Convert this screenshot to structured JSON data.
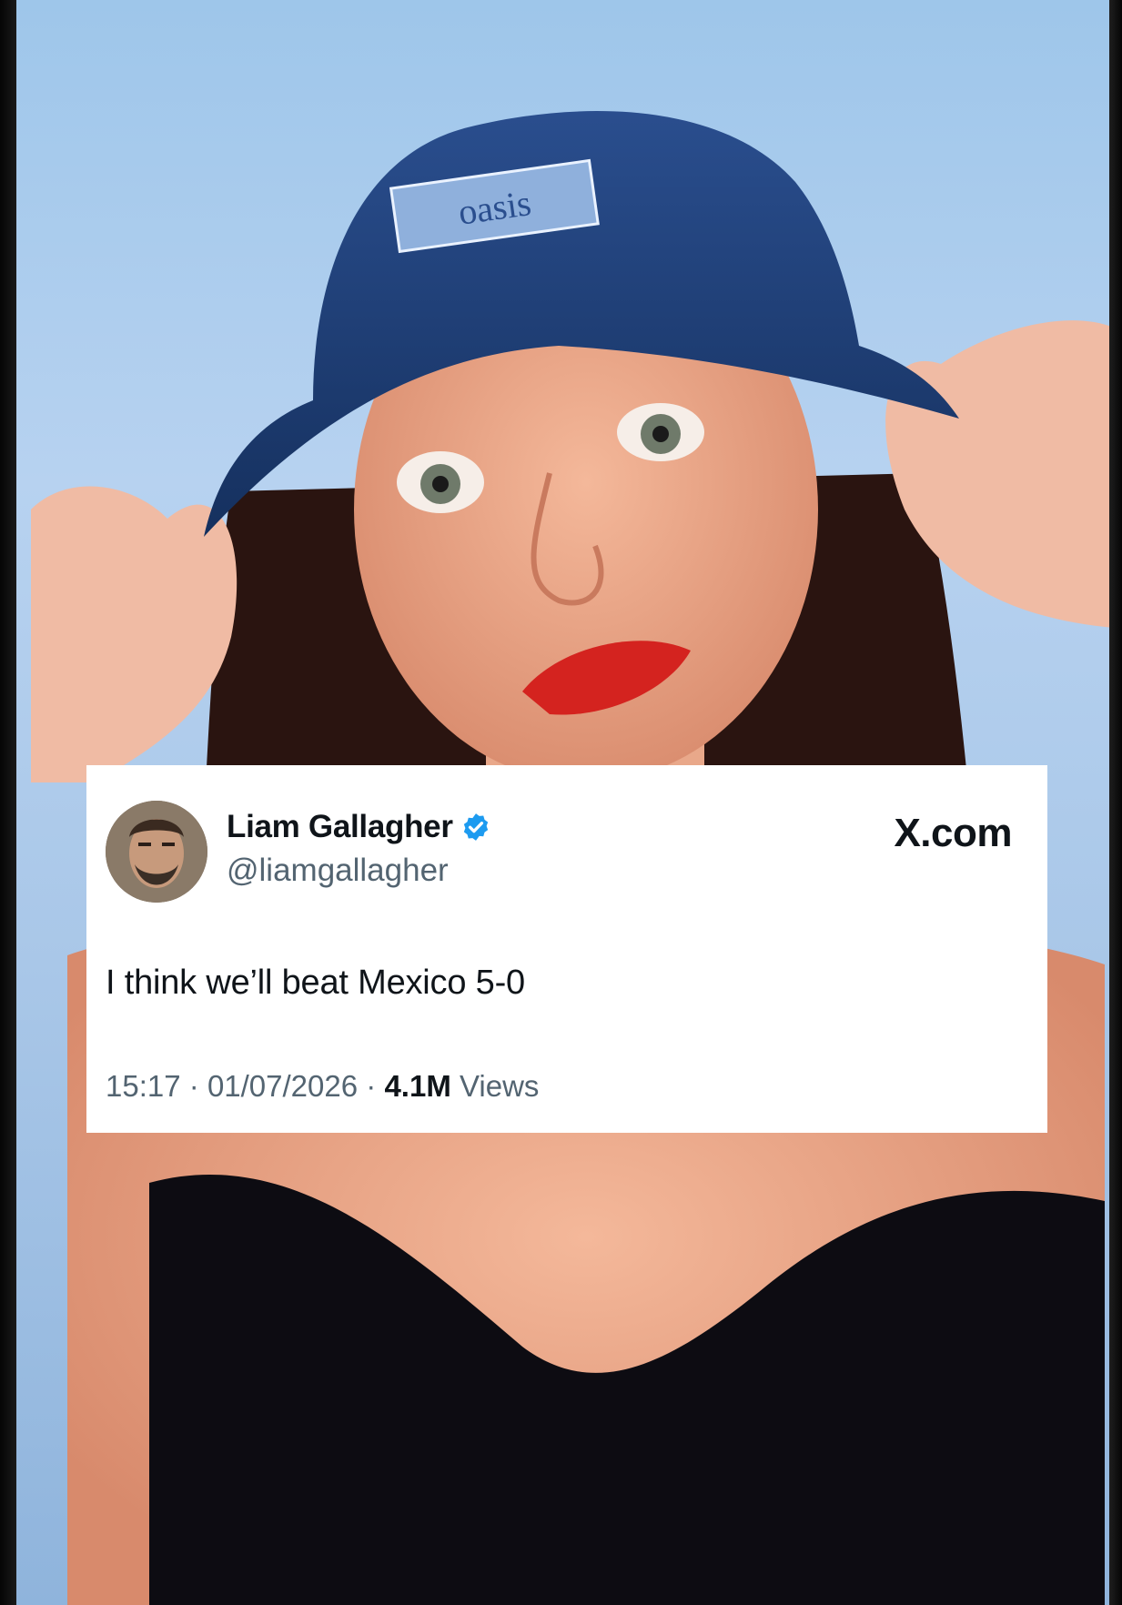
{
  "photo": {
    "hat_logo_text": "oasis",
    "hat_color": "#1f3f7a",
    "background_color": "#a9c7e8"
  },
  "tweet": {
    "display_name": "Liam Gallagher",
    "handle": "@liamgallagher",
    "verified_icon": "verified-badge-icon",
    "verified_color": "#1d9bf0",
    "brand": "X.com",
    "text": "I think we’ll beat Mexico 5-0",
    "time": "15:17",
    "date": "01/07/2026",
    "separator": "·",
    "views_count": "4.1M",
    "views_label": "Views"
  }
}
